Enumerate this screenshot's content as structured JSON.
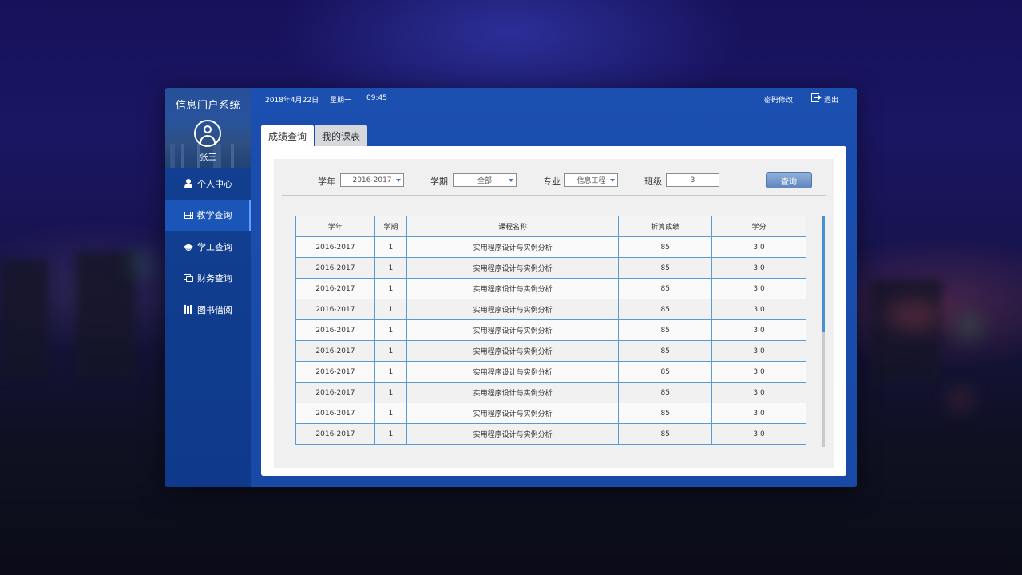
{
  "sidebar": {
    "title": "信息门户系统",
    "username": "张三",
    "items": [
      {
        "label": "个人中心",
        "icon": "user-icon"
      },
      {
        "label": "教学查询",
        "icon": "table-icon"
      },
      {
        "label": "学工查询",
        "icon": "graduation-cap-icon"
      },
      {
        "label": "财务查询",
        "icon": "money-icon"
      },
      {
        "label": "图书借阅",
        "icon": "book-icon"
      }
    ],
    "active_index": 1
  },
  "header": {
    "date": "2018年4月22日",
    "weekday": "星期一",
    "time": "09:45",
    "change_password": "密码修改",
    "logout": "退出"
  },
  "tabs": [
    {
      "label": "成绩查询",
      "active": true
    },
    {
      "label": "我的课表",
      "active": false
    }
  ],
  "filters": {
    "year_label": "学年",
    "year_value": "2016-2017",
    "term_label": "学期",
    "term_value": "全部",
    "major_label": "专业",
    "major_value": "信息工程",
    "class_label": "班级",
    "class_value": "3",
    "query_button": "查询"
  },
  "table": {
    "headers": [
      "学年",
      "学期",
      "课程名称",
      "折算成绩",
      "学分"
    ],
    "rows": [
      [
        "2016-2017",
        "1",
        "实用程序设计与实例分析",
        "85",
        "3.0"
      ],
      [
        "2016-2017",
        "1",
        "实用程序设计与实例分析",
        "85",
        "3.0"
      ],
      [
        "2016-2017",
        "1",
        "实用程序设计与实例分析",
        "85",
        "3.0"
      ],
      [
        "2016-2017",
        "1",
        "实用程序设计与实例分析",
        "85",
        "3.0"
      ],
      [
        "2016-2017",
        "1",
        "实用程序设计与实例分析",
        "85",
        "3.0"
      ],
      [
        "2016-2017",
        "1",
        "实用程序设计与实例分析",
        "85",
        "3.0"
      ],
      [
        "2016-2017",
        "1",
        "实用程序设计与实例分析",
        "85",
        "3.0"
      ],
      [
        "2016-2017",
        "1",
        "实用程序设计与实例分析",
        "85",
        "3.0"
      ],
      [
        "2016-2017",
        "1",
        "实用程序设计与实例分析",
        "85",
        "3.0"
      ],
      [
        "2016-2017",
        "1",
        "实用程序设计与实例分析",
        "85",
        "3.0"
      ]
    ]
  },
  "colors": {
    "window_blue": "#1b4fb0",
    "sidebar_blue": "#0f3a8c",
    "table_border": "#5b9bd5",
    "accent": "#4b8fd3"
  }
}
